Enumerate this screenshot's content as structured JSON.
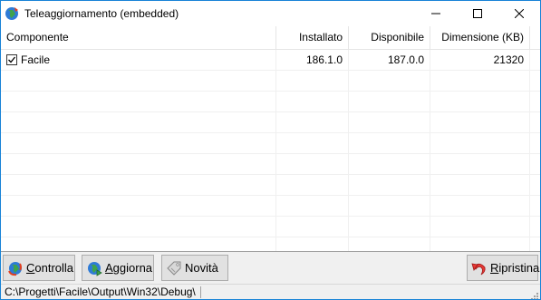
{
  "window": {
    "title": "Teleaggiornamento (embedded)",
    "controls": [
      "minimize-icon",
      "maximize-icon",
      "close-icon"
    ]
  },
  "list": {
    "columns": [
      "Componente",
      "Installato",
      "Disponibile",
      "Dimensione (KB)"
    ],
    "rows": [
      {
        "checked": true,
        "componente": "Facile",
        "installato": "186.1.0",
        "disponibile": "187.0.0",
        "dimensione": "21320"
      }
    ]
  },
  "toolbar": {
    "controlla": {
      "accel": "C",
      "rest": "ontrolla",
      "icon": "globe-refresh-icon"
    },
    "aggiorna": {
      "accel": "A",
      "rest": "ggiorna",
      "icon": "globe-update-icon"
    },
    "novita": {
      "label": "Novità",
      "icon": "tag-icon"
    },
    "ripristina": {
      "accel": "R",
      "rest": "ipristina",
      "icon": "undo-arrow-icon"
    }
  },
  "statusbar": {
    "path": "C:\\Progetti\\Facile\\Output\\Win32\\Debug\\"
  },
  "colors": {
    "window_border": "#1883d7",
    "button_face": "#e1e1e1",
    "button_border": "#adadad"
  }
}
